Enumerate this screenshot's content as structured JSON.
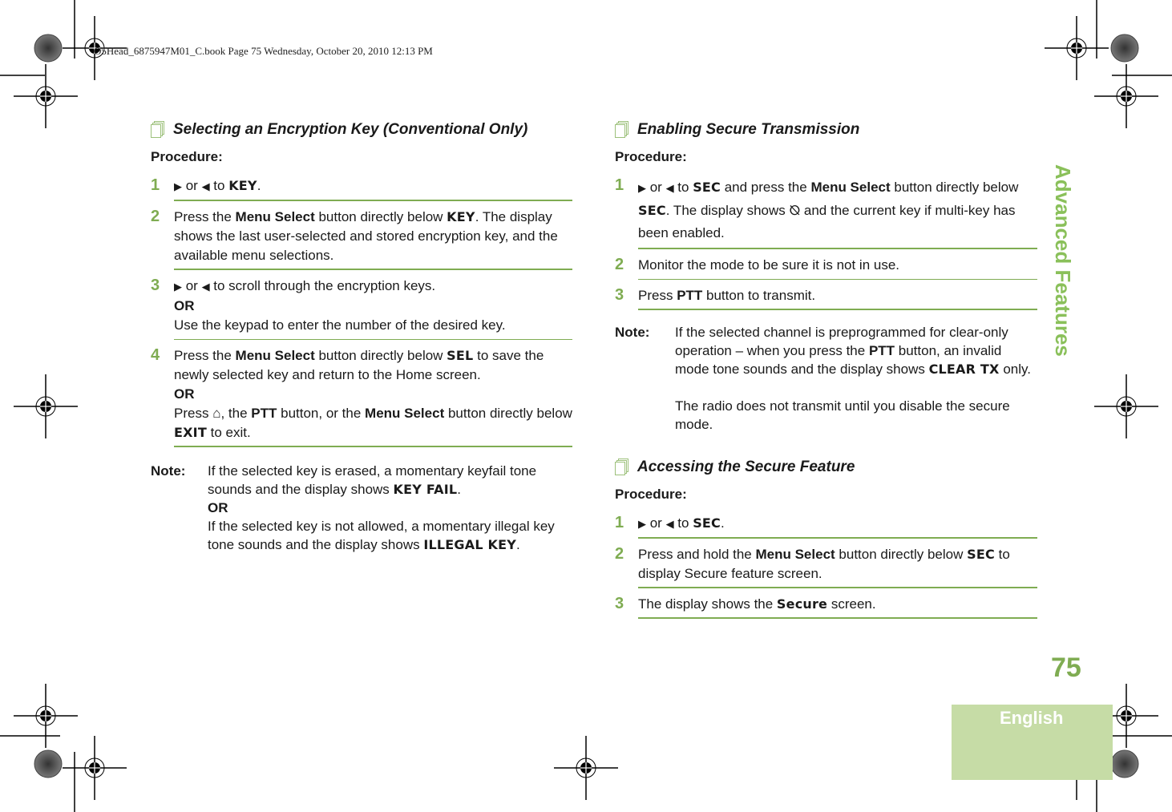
{
  "print_header": "O5Head_6875947M01_C.book  Page 75  Wednesday, October 20, 2010  12:13 PM",
  "side_tab": "Advanced Features",
  "page_number": "75",
  "language_tab": "English",
  "accent_color": "#7fac52",
  "left": {
    "title": "Selecting an Encryption Key (Conventional Only)",
    "procedure_label": "Procedure:",
    "steps": [
      {
        "num": "1",
        "right_icon": "▶",
        "or": " or ",
        "left_icon": "◀",
        "to": " to ",
        "lcd": "KEY",
        "end": "."
      },
      {
        "num": "2",
        "a": "Press the ",
        "b": "Menu Select",
        "c": " button directly below ",
        "lcd": "KEY",
        "d": ". The display shows the last user-selected and stored encryption key, and the available menu selections."
      },
      {
        "num": "3",
        "right_icon": "▶",
        "or": " or ",
        "left_icon": "◀",
        "a": " to scroll through the encryption keys.",
        "or_label": "OR",
        "b": "Use the keypad to enter the number of the desired key."
      },
      {
        "num": "4",
        "a": "Press the ",
        "b": "Menu Select",
        "c": " button directly below ",
        "lcd": "SEL",
        "d": " to save the newly selected key and return to the Home screen.",
        "or_label": "OR",
        "e": "Press ",
        "home_icon": "⌂",
        "f": ", the ",
        "g": "PTT",
        "h": " button, or the ",
        "i": "Menu Select",
        "j": " button directly below ",
        "lcd2": "EXIT",
        "k": " to exit."
      }
    ],
    "note": {
      "label": "Note:",
      "a": "If the selected key is erased, a momentary keyfail tone sounds and the display shows ",
      "lcd1": "KEY FAIL",
      "b": ".",
      "or_label": "OR",
      "c": "If the selected key is not allowed, a momentary illegal key tone sounds and the display shows ",
      "lcd2": "ILLEGAL KEY",
      "d": "."
    }
  },
  "right": {
    "section1": {
      "title": "Enabling Secure Transmission",
      "procedure_label": "Procedure:",
      "steps": [
        {
          "num": "1",
          "right_icon": "▶",
          "or": " or ",
          "left_icon": "◀",
          "to": " to ",
          "lcd": "SEC",
          "a": " and press the ",
          "b": "Menu Select",
          "c": " button directly below ",
          "lcd2": "SEC",
          "d": ". The display shows ",
          "secure_icon": "⦰",
          "e": " and the current key if multi-key has been enabled."
        },
        {
          "num": "2",
          "a": "Monitor the mode to be sure it is not in use."
        },
        {
          "num": "3",
          "a": "Press ",
          "b": "PTT",
          "c": " button to transmit."
        }
      ],
      "note": {
        "label": "Note:",
        "a": "If the selected channel is preprogrammed for clear-only operation – when you press the ",
        "b": "PTT",
        "c": " button, an invalid mode tone sounds and the display shows ",
        "lcd": "CLEAR TX",
        "d": " only.",
        "e": "The radio does not transmit until you disable the secure mode."
      }
    },
    "section2": {
      "title": "Accessing the Secure Feature",
      "procedure_label": "Procedure:",
      "steps": [
        {
          "num": "1",
          "right_icon": "▶",
          "or": " or ",
          "left_icon": "◀",
          "to": " to ",
          "lcd": "SEC",
          "end": "."
        },
        {
          "num": "2",
          "a": "Press and hold the ",
          "b": "Menu Select",
          "c": " button directly below ",
          "lcd": "SEC",
          "d": " to display Secure feature screen."
        },
        {
          "num": "3",
          "a": "The display shows the ",
          "lcd": "Secure",
          "b": " screen."
        }
      ]
    }
  }
}
